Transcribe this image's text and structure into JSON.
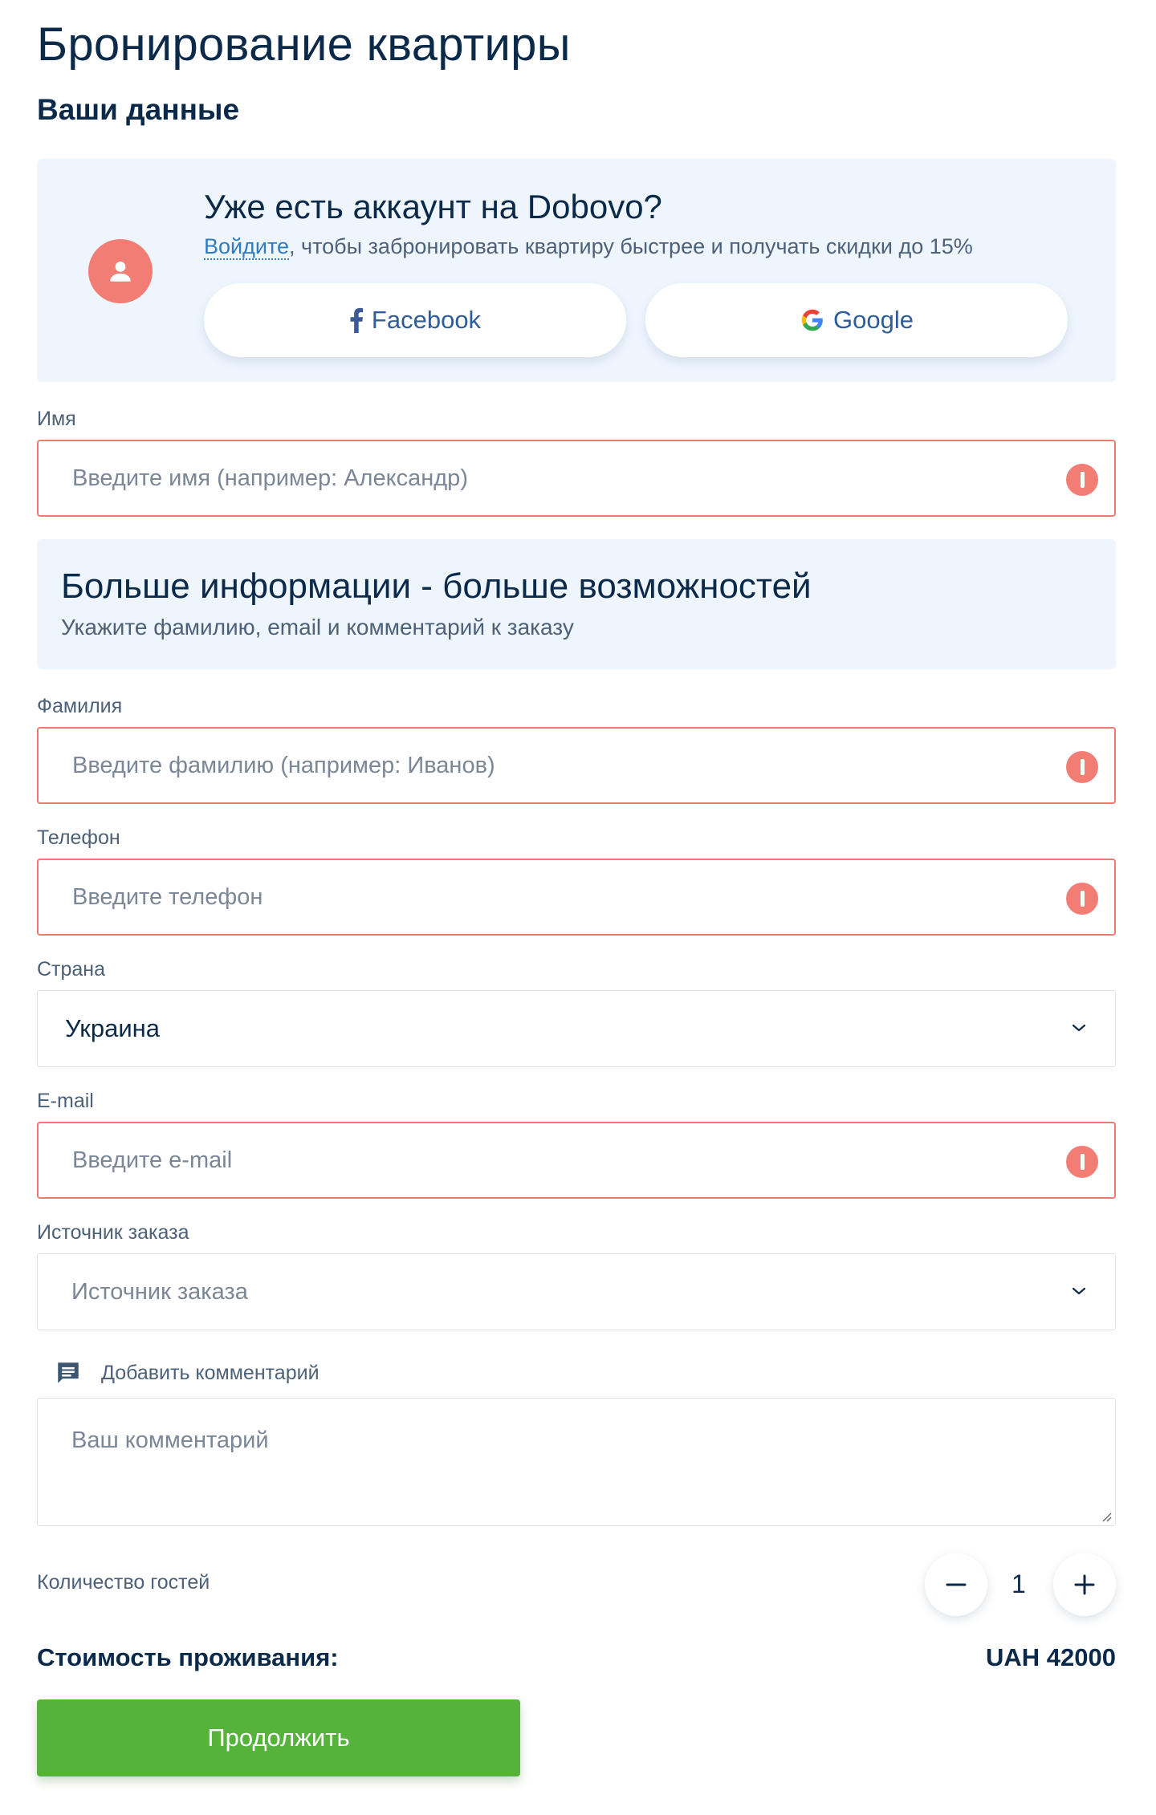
{
  "header": {
    "title": "Бронирование квартиры",
    "section": "Ваши данные"
  },
  "login": {
    "heading": "Уже есть аккаунт на Dobovo?",
    "link": "Войдите",
    "text": ", чтобы забронировать квартиру быстрее и получать скидки до 15%",
    "facebook": "Facebook",
    "google": "Google"
  },
  "fields": {
    "name": {
      "label": "Имя",
      "placeholder": "Введите имя (например: Александр)"
    },
    "surname": {
      "label": "Фамилия",
      "placeholder": "Введите фамилию (например: Иванов)"
    },
    "phone": {
      "label": "Телефон",
      "placeholder": "Введите телефон"
    },
    "country": {
      "label": "Страна",
      "value": "Украина"
    },
    "email": {
      "label": "E-mail",
      "placeholder": "Введите e-mail"
    },
    "source": {
      "label": "Источник заказа",
      "placeholder": "Источник заказа"
    }
  },
  "info": {
    "heading": "Больше информации - больше возможностей",
    "text": "Укажите фамилию, email и комментарий к заказу"
  },
  "comment": {
    "toggle": "Добавить комментарий",
    "placeholder": "Ваш комментарий"
  },
  "guests": {
    "label": "Количество гостей",
    "count": "1"
  },
  "price": {
    "label": "Стоимость проживания:",
    "value": "UAH 42000"
  },
  "actions": {
    "continue": "Продолжить"
  },
  "colors": {
    "accent": "#2f7dc1",
    "error": "#f27d75",
    "primary_button": "#55b33c",
    "title": "#0b2a4a",
    "panel_bg": "#eef5fd"
  }
}
